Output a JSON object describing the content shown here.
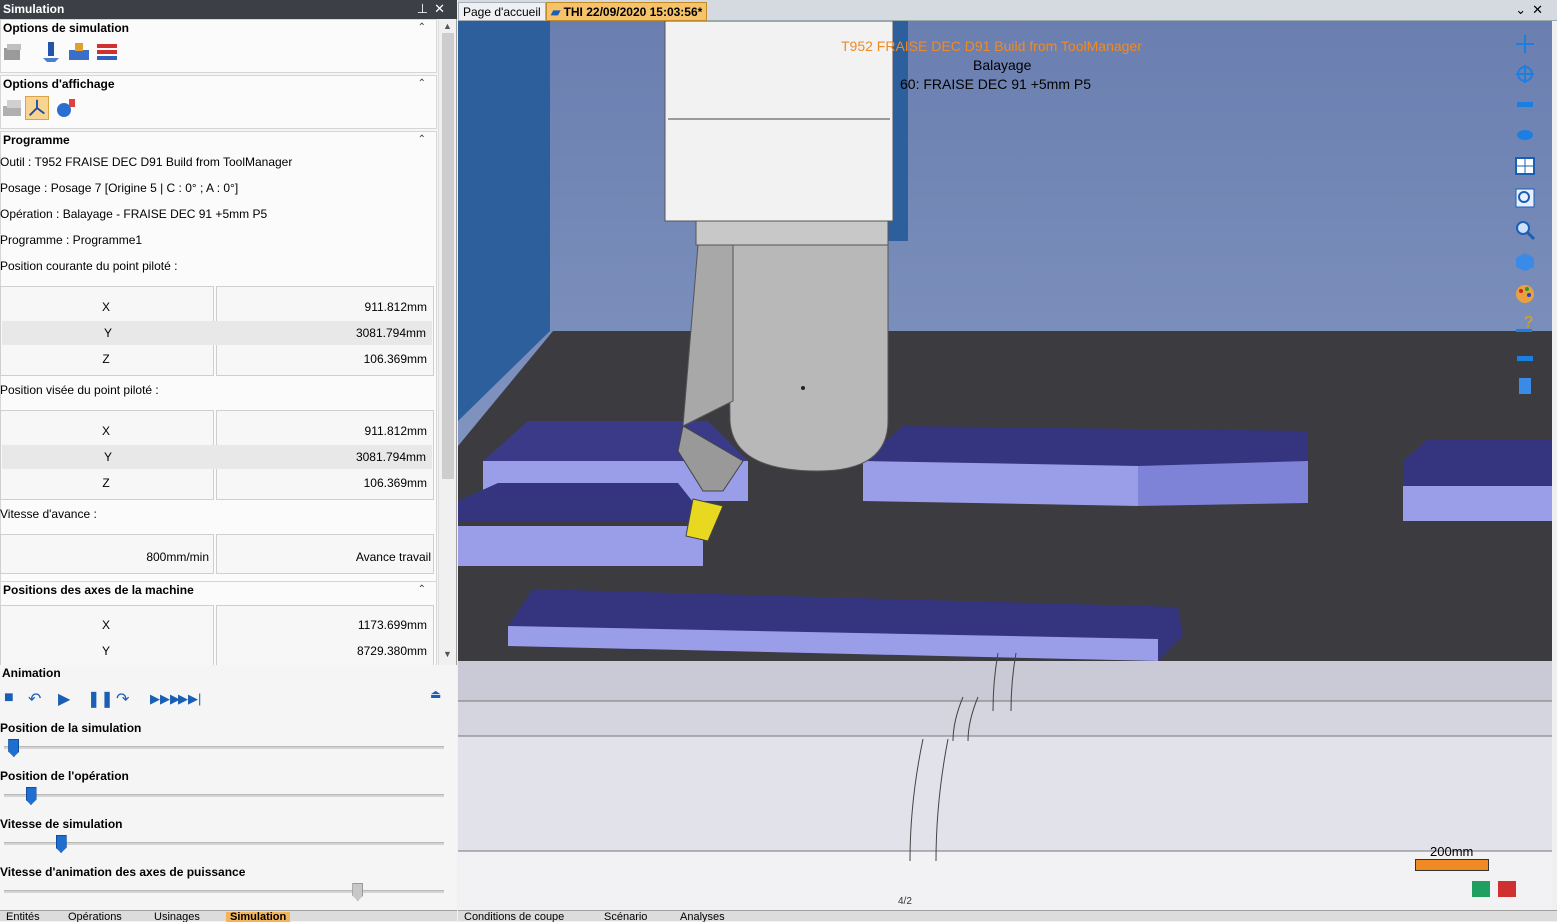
{
  "left_panel": {
    "title": "Simulation",
    "sections": {
      "options_simulation": "Options de simulation",
      "options_affichage": "Options d'affichage",
      "programme": "Programme"
    },
    "programme": {
      "outil": "Outil : T952 FRAISE DEC D91 Build from ToolManager",
      "posage": "Posage : Posage 7 [Origine 5 | C : 0° ; A : 0°]",
      "operation": "Opération : Balayage - FRAISE DEC 91 +5mm P5",
      "programme": "Programme : Programme1",
      "pos_courante_label": "Position courante du point piloté :",
      "pos_visee_label": "Position visée du point piloté :",
      "vitesse_avance_label": "Vitesse d'avance :",
      "axes_machine_label": "Positions des axes de la machine"
    },
    "pos_courante": [
      {
        "axis": "X",
        "value": "911.812mm"
      },
      {
        "axis": "Y",
        "value": "3081.794mm"
      },
      {
        "axis": "Z",
        "value": "106.369mm"
      }
    ],
    "pos_visee": [
      {
        "axis": "X",
        "value": "911.812mm"
      },
      {
        "axis": "Y",
        "value": "3081.794mm"
      },
      {
        "axis": "Z",
        "value": "106.369mm"
      }
    ],
    "vitesse": {
      "value": "800mm/min",
      "mode": "Avance travail"
    },
    "axes_machine": [
      {
        "axis": "X",
        "value": "1173.699mm"
      },
      {
        "axis": "Y",
        "value": "8729.380mm"
      }
    ],
    "animation": {
      "title": "Animation",
      "pos_simulation": "Position de la simulation",
      "pos_operation": "Position de l'opération",
      "vitesse_simulation": "Vitesse de simulation",
      "vitesse_axes": "Vitesse d'animation des axes de puissance",
      "pos_simulation_level": 0.01,
      "pos_operation_level": 0.05,
      "vitesse_simulation_level": 0.12,
      "vitesse_axes_level": 0.81
    },
    "bottom_tabs": [
      "Entités",
      "Opérations",
      "Usinages",
      "Simulation"
    ]
  },
  "doc_tabs": {
    "home": "Page d'accueil",
    "active": "THI 22/09/2020 15:03:56*"
  },
  "viewport": {
    "tool_line": "T952 FRAISE DEC D91 Build from ToolManager",
    "op_type": "Balayage",
    "op_name": "60: FRAISE DEC 91 +5mm P5",
    "scale": "200mm",
    "axis_mark": "4/2"
  },
  "viewport_tabs": [
    "Conditions de coupe",
    "Scénario",
    "Analyses"
  ],
  "colors": {
    "accent": "#f2b55a",
    "tool_text": "#f08a24",
    "part": "#9a9ee8",
    "table": "#3a3a3e"
  }
}
